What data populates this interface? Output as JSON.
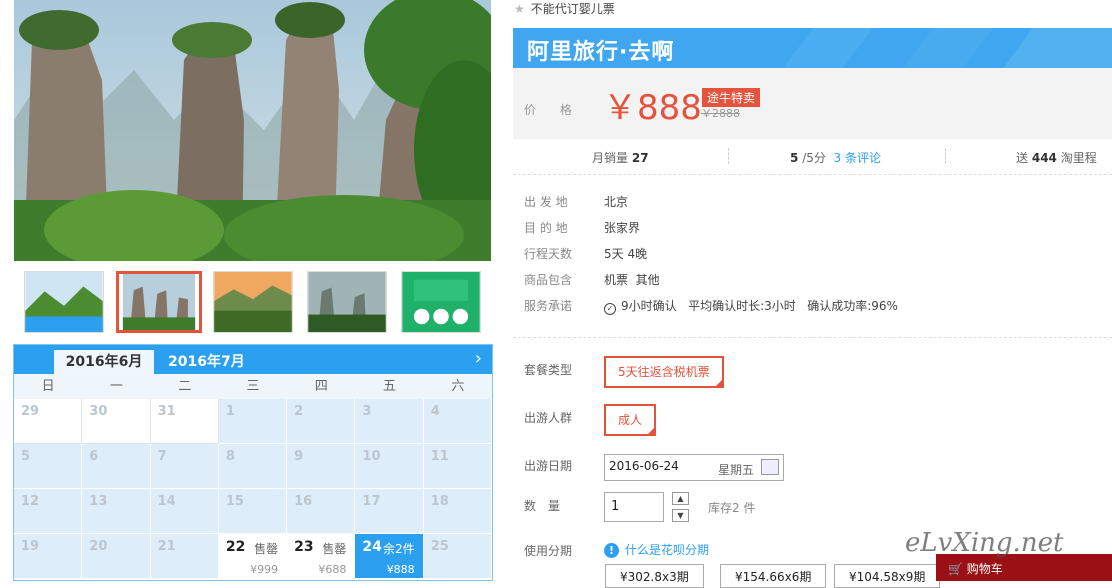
{
  "notice": "不能代订婴儿票",
  "brand": "阿里旅行·去啊",
  "price": {
    "label": "价 格",
    "value": "￥888",
    "promo_tag": "途牛特卖",
    "original": "￥2888"
  },
  "stats": {
    "sales_label": "月销量",
    "sales_value": "27",
    "score": "5",
    "score_suffix": "/5分",
    "reviews": "3 条评论",
    "points_prefix": "送",
    "points_value": "444",
    "points_suffix": "淘里程"
  },
  "info": [
    {
      "key": "出 发 地",
      "value": "北京"
    },
    {
      "key": "目 的 地",
      "value": "张家界"
    },
    {
      "key": "行程天数",
      "value": "5天 4晚"
    },
    {
      "key": "商品包含",
      "value": "机票  其他"
    }
  ],
  "service": {
    "key": "服务承诺",
    "confirm": "9小时确认",
    "avg": "平均确认时长:3小时",
    "rate": "确认成功率:96%"
  },
  "options": {
    "package_label": "套餐类型",
    "package_value": "5天往返含税机票",
    "crowd_label": "出游人群",
    "crowd_value": "成人",
    "date_label": "出游日期",
    "date_value": "2016-06-24",
    "weekday": "星期五",
    "qty_label": "数　量",
    "qty_value": "1",
    "stock": "库存2 件",
    "installment_label": "使用分期",
    "installment_link": "什么是花呗分期",
    "installments": [
      "¥302.8x3期",
      "¥154.66x6期",
      "¥104.58x9期"
    ]
  },
  "calendar": {
    "month_active": "2016年6月",
    "month_next": "2016年7月",
    "weekdays": [
      "日",
      "一",
      "二",
      "三",
      "四",
      "五",
      "六"
    ],
    "rows": [
      [
        {
          "d": "29",
          "s": "white"
        },
        {
          "d": "30",
          "s": "white"
        },
        {
          "d": "31",
          "s": "white"
        },
        {
          "d": "1"
        },
        {
          "d": "2"
        },
        {
          "d": "3"
        },
        {
          "d": "4"
        }
      ],
      [
        {
          "d": "5"
        },
        {
          "d": "6"
        },
        {
          "d": "7"
        },
        {
          "d": "8"
        },
        {
          "d": "9"
        },
        {
          "d": "10"
        },
        {
          "d": "11"
        }
      ],
      [
        {
          "d": "12"
        },
        {
          "d": "13"
        },
        {
          "d": "14"
        },
        {
          "d": "15"
        },
        {
          "d": "16"
        },
        {
          "d": "17"
        },
        {
          "d": "18"
        }
      ],
      [
        {
          "d": "19"
        },
        {
          "d": "20"
        },
        {
          "d": "21"
        },
        {
          "d": "22",
          "s": "avail",
          "tag": "售罄",
          "price": "¥999"
        },
        {
          "d": "23",
          "s": "avail",
          "tag": "售罄",
          "price": "¥688"
        },
        {
          "d": "24",
          "s": "selected",
          "tag": "余2件",
          "price": "¥888"
        },
        {
          "d": "25"
        }
      ]
    ]
  },
  "cart": "购物车",
  "watermark": "eLvXing.net",
  "colors": {
    "accent": "#2ba0f0",
    "price": "#e4533b",
    "cart": "#9b1014"
  }
}
